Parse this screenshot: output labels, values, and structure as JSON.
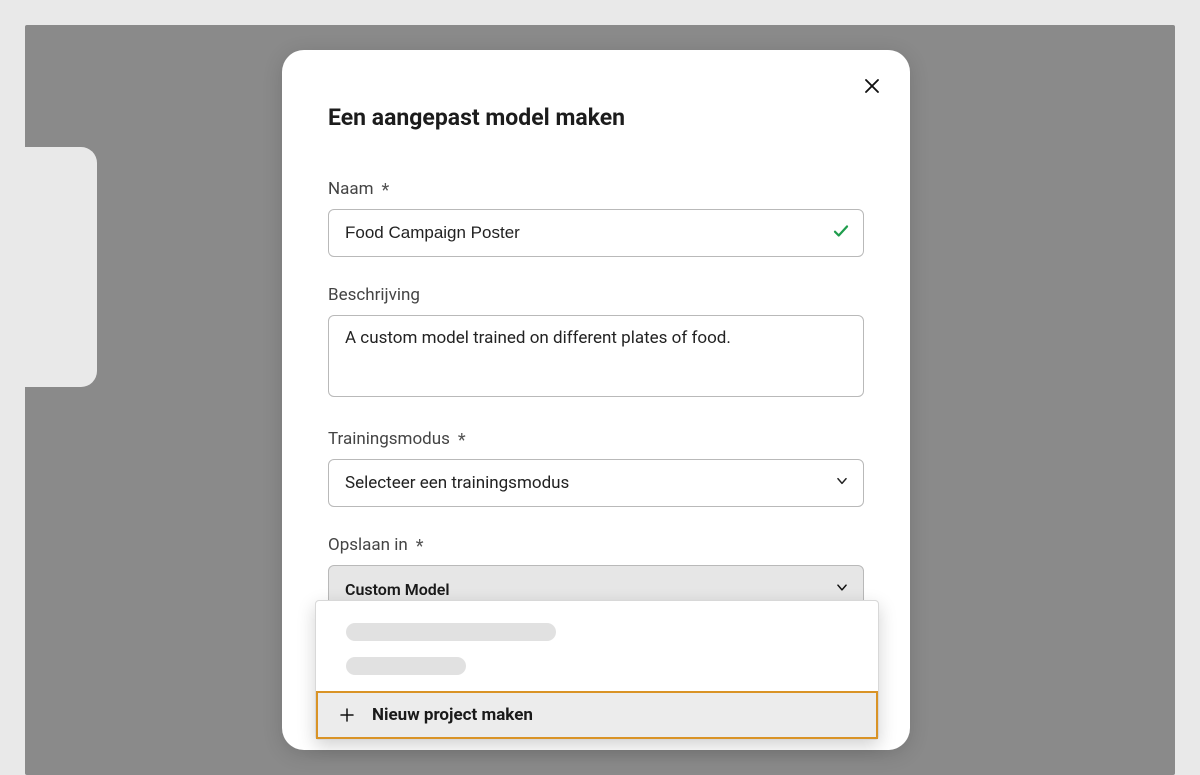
{
  "modal": {
    "title": "Een aangepast model maken",
    "close_label": "close",
    "fields": {
      "name": {
        "label": "Naam",
        "required": true,
        "value": "Food Campaign Poster",
        "valid": true
      },
      "description": {
        "label": "Beschrijving",
        "required": false,
        "value": "A custom model trained on different plates of food."
      },
      "training_mode": {
        "label": "Trainingsmodus",
        "required": true,
        "placeholder": "Selecteer een trainingsmodus"
      },
      "save_in": {
        "label": "Opslaan in",
        "required": true,
        "selected": "Custom Model"
      }
    }
  },
  "dropdown": {
    "new_project_label": "Nieuw project maken"
  }
}
